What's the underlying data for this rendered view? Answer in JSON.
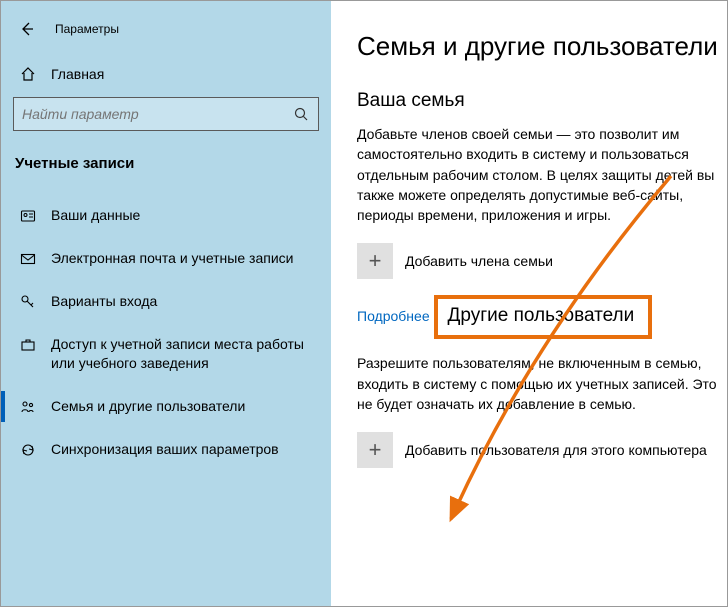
{
  "window": {
    "title": "Параметры"
  },
  "sidebar": {
    "home_label": "Главная",
    "search_placeholder": "Найти параметр",
    "category": "Учетные записи",
    "items": [
      {
        "label": "Ваши данные"
      },
      {
        "label": "Электронная почта и учетные записи"
      },
      {
        "label": "Варианты входа"
      },
      {
        "label": "Доступ к учетной записи места работы или учебного заведения"
      },
      {
        "label": "Семья и другие пользователи"
      },
      {
        "label": "Синхронизация ваших параметров"
      }
    ]
  },
  "main": {
    "heading": "Семья и другие пользователи",
    "family_heading": "Ваша семья",
    "family_text": "Добавьте членов своей семьи — это позволит им самостоятельно входить в систему и пользоваться отдельным рабочим столом. В целях защиты детей вы также можете определять допустимые веб-сайты, периоды времени, приложения и игры.",
    "add_family": "Добавить члена семьи",
    "learn_more": "Подробнее",
    "others_heading": "Другие пользователи",
    "others_text": "Разрешите пользователям, не включенным в семью, входить в систему с помощью их учетных записей. Это не будет означать их добавление в семью.",
    "add_other": "Добавить пользователя для этого компьютера"
  },
  "annotation": {
    "highlight_color": "#e86f0d",
    "arrow_color": "#e86f0d"
  }
}
